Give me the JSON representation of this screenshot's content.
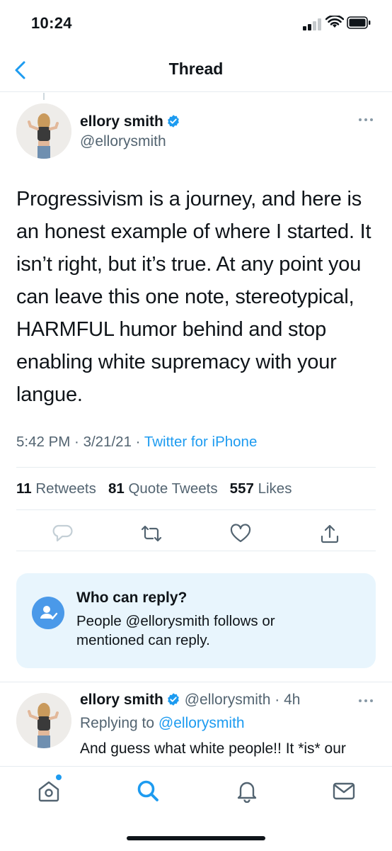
{
  "status_bar": {
    "time": "10:24"
  },
  "header": {
    "title": "Thread"
  },
  "tweet": {
    "name": "ellory smith",
    "handle": "@ellorysmith",
    "text": "Progressivism is a journey, and here is an honest example of where I started. It isn’t right, but it’s true. At any point you can leave this one note, stereotypical, HARMFUL humor behind and stop enabling white supremacy with your langue.",
    "time": "5:42 PM",
    "date": "3/21/21",
    "source": "Twitter for iPhone",
    "retweets_count": "11",
    "retweets_label": "Retweets",
    "quotes_count": "81",
    "quotes_label": "Quote Tweets",
    "likes_count": "557",
    "likes_label": "Likes"
  },
  "reply_restriction": {
    "title": "Who can reply?",
    "description": "People @ellorysmith follows or mentioned can reply."
  },
  "reply": {
    "name": "ellory smith",
    "handle": "@ellorysmith",
    "age": "4h",
    "replying_prefix": "Replying to",
    "replying_to": "@ellorysmith",
    "text_line1": "And guess what white people!! It *is* our"
  },
  "colors": {
    "accent": "#1d9bf0",
    "secondary_text": "#536471",
    "card_bg": "#e8f5fd"
  },
  "icons": {
    "back": "chevron-left-icon",
    "verified": "verified-badge-icon",
    "more": "more-dots-icon",
    "reply": "reply-icon",
    "retweet": "retweet-icon",
    "like": "heart-icon",
    "share": "share-icon",
    "home": "home-icon",
    "search": "search-icon",
    "notifications": "bell-icon",
    "messages": "mail-icon"
  }
}
